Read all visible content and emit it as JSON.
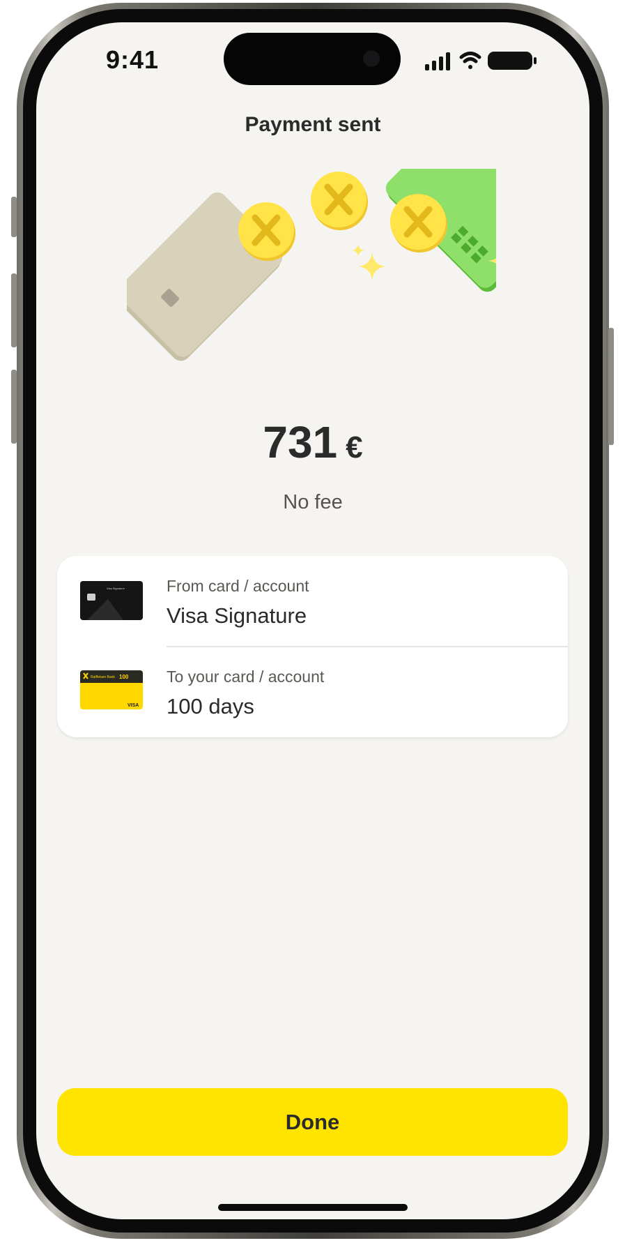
{
  "status_bar": {
    "time": "9:41"
  },
  "header": {
    "title": "Payment sent"
  },
  "payment": {
    "amount": "731",
    "currency": "€",
    "fee_text": "No fee"
  },
  "details": {
    "from": {
      "label": "From card / account",
      "value": "Visa Signature",
      "card_image": "black-visa-signature-card",
      "card_name_text": "Visa Signature"
    },
    "to": {
      "label": "To your card / account",
      "value": "100 days",
      "card_image": "yellow-raiffeisen-100-days-card",
      "bank_text": "Raiffeisen Bank",
      "badge_text": "100",
      "network_text": "VISA"
    }
  },
  "actions": {
    "done_label": "Done"
  },
  "colors": {
    "background": "#f5f4f1",
    "accent": "#ffe400",
    "coin": "#ffe347",
    "card_green": "#8ee06a",
    "card_beige": "#d9d2bb",
    "text_primary": "#2b2b2b",
    "text_secondary": "#5b5853"
  },
  "icons": [
    "cellular-signal-icon",
    "wifi-icon",
    "battery-icon",
    "sparkle-icon",
    "coin-icon"
  ]
}
